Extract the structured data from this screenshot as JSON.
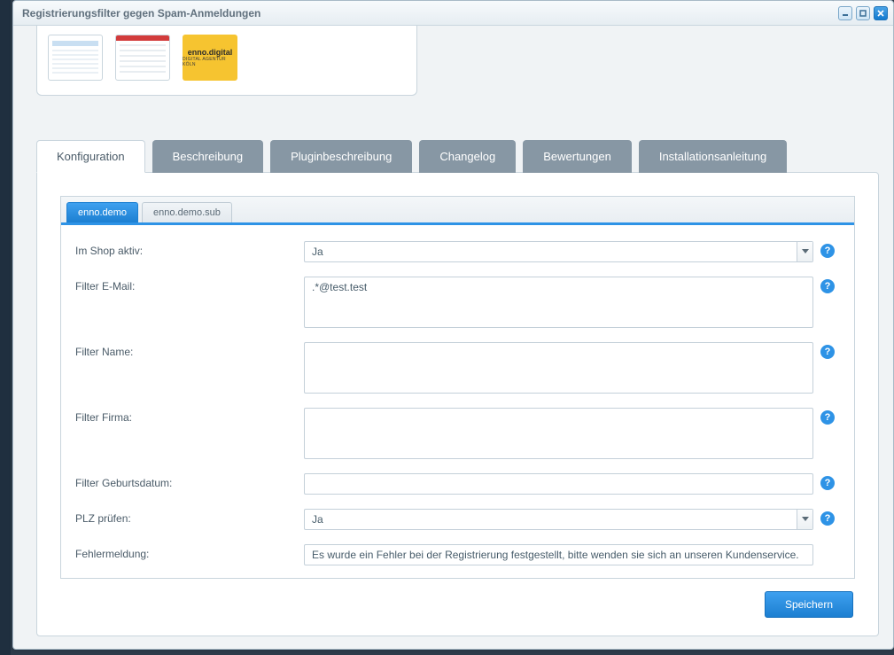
{
  "window": {
    "title": "Registrierungsfilter gegen Spam-Anmeldungen"
  },
  "thumbs": {
    "logo_brand": "enno.digital",
    "logo_tagline": "DIGITAL AGENTUR KÖLN"
  },
  "tabs": {
    "config": "Konfiguration",
    "desc": "Beschreibung",
    "plugindesc": "Pluginbeschreibung",
    "changelog": "Changelog",
    "reviews": "Bewertungen",
    "install": "Installationsanleitung"
  },
  "subtabs": {
    "main": "enno.demo",
    "sub": "enno.demo.sub"
  },
  "form": {
    "active_label": "Im Shop aktiv:",
    "active_value": "Ja",
    "filter_email_label": "Filter E-Mail:",
    "filter_email_value": ".*@test.test",
    "filter_name_label": "Filter Name:",
    "filter_name_value": "",
    "filter_company_label": "Filter Firma:",
    "filter_company_value": "",
    "filter_birth_label": "Filter Geburtsdatum:",
    "filter_birth_value": "",
    "zip_label": "PLZ prüfen:",
    "zip_value": "Ja",
    "error_label": "Fehlermeldung:",
    "error_value": "Es wurde ein Fehler bei der Registrierung festgestellt, bitte wenden sie sich an unseren Kundenservice."
  },
  "buttons": {
    "save": "Speichern"
  }
}
